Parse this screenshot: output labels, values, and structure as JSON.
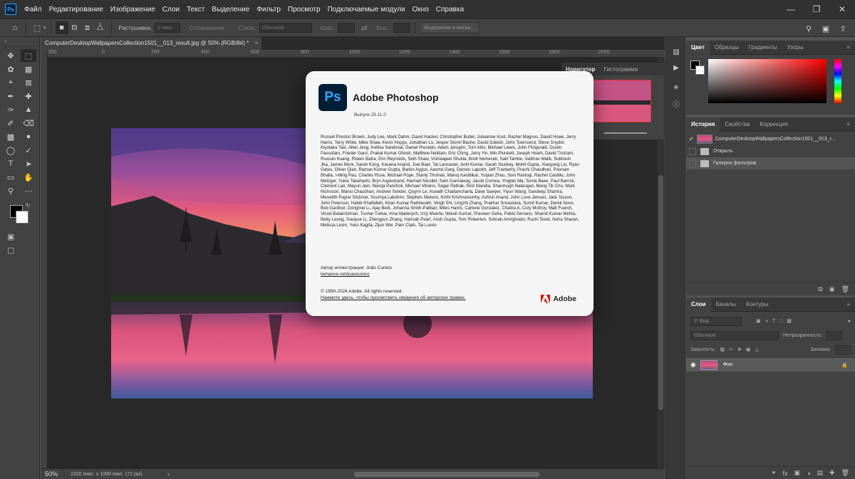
{
  "menubar": {
    "logo": "Ps",
    "items": [
      "Файл",
      "Редактирование",
      "Изображение",
      "Слои",
      "Текст",
      "Выделение",
      "Фильтр",
      "Просмотр",
      "Подключаемые модули",
      "Окно",
      "Справка"
    ]
  },
  "optbar": {
    "feather_label": "Растушевка:",
    "feather_value": "0 пикс.",
    "smoothing_label": "Сглаживание",
    "style_label": "Стиль:",
    "style_value": "Обычный",
    "width_label": "Шир.:",
    "height_label": "Выс.:",
    "select_mask_button": "Выделение и маска..."
  },
  "document": {
    "tab_title": "ComputerDesktopWallpapersCollection1501__013_result.jpg @ 50% (RGB/8#) *",
    "ruler_marks": [
      "200",
      "0",
      "200",
      "400",
      "600",
      "800",
      "1000",
      "1200",
      "1400",
      "1600",
      "1800",
      "2000"
    ],
    "zoom": "50%",
    "info": "1920 пикс. x 1080 пикс. (72 ppi)"
  },
  "navigator": {
    "tabs": [
      "Навигатор",
      "Гистограмма"
    ]
  },
  "color_panel": {
    "tabs": [
      "Цвет",
      "Образцы",
      "Градиенты",
      "Узоры"
    ]
  },
  "history_panel": {
    "tabs": [
      "История",
      "Свойства",
      "Коррекция"
    ],
    "snapshot": "ComputerDesktopWallpapersCollection1501__013_r...",
    "items": [
      "Открыть",
      "Галерея фильтров"
    ]
  },
  "layers_panel": {
    "tabs": [
      "Слои",
      "Каналы",
      "Контуры"
    ],
    "kind_placeholder": "Вид",
    "blend_mode": "Обычные",
    "opacity_label": "Непрозрачность:",
    "lock_label": "Закрепить:",
    "fill_label": "Заливка:",
    "layer_name": "Фон"
  },
  "about": {
    "logo": "Ps",
    "app_name": "Adobe Photoshop",
    "version": "Выпуск 25.11.0",
    "credits": "Russell Preston Brown, Judy Lee, Mark Dahm, David Hackel, Christopher Butler, Julieanne Kost, Rachel Magnus, David Howe, Jerry Harris, Terry White, Mike Shaw, Kevin Hopps, Jonathan Lo, Jesper Storm Bache, David Dobish, John Townsend, Steve Snyder, Kiyotaka Taki, Allen Jeng, Kellisa Sandoval, Daniel Presedo, Adam Jerugim, Tom Attix, Michael Lewis, John Fitzgerald, Dustin Passofaro, Frieder Ganz, Prabal Kumar Ghosh, Matthew Neldam, Eric Ching, Jerry Yin, Min Plunkett, Joseph Hsieh, David Tristram, Ruxuan Kuang, Ridam Batra, Erin Reynolds, Seth Shaw, Vishwajeet Shukla, Brett Nemecek, Salil Tambe, Vaibhav Malik, Subhash Jha, James Mork, Sarah Kong, Kavana Anand, Joel Baer, Tal Lancaster, Amit Kumar, Sarah Stuckey, Mohit Gupta, Xiaoyang Liu, Ryan Gates, Oliver Qian, Raman Kumar Gupta, Barkin Aygun, Aasma Garg, Damon Lapoint, Jeff Tranberry, Prachi Chaudhari, Poonam Bhalla, I-Ming Pao, Charles Rose, Michael Pope, Stanly Thomas, Manoj Kandlikar, Yuqian Zhou, Soni Rastogi, Rachel Castillo, John Metzger, Yukie Takahashi, Bryn Aspestrand, Hannah Nicollet, Sam Gannaway, Jacob Correia, Yinglan Ma, Sonia Baee, Paul Barrick, Clement Lan, Mayuri Jain, Neerja Pancholi, Michael Vitrano, Sagar Pathak, Rick Mandia, Shanmugh Natarajan, Mang Tik Chu, Mark Nichoson, Mansi Chaudhari, Andrew Sender, Quynn Le, Aswath Challamcharla, Dave Sawyer, Yiyun Wang, Sandeep Sharma, Meredith Payne Stotzner, Soumya Lakshmi, Stephen Nielson, Kirthi Krishnamurthy, Ashish Anand, John Love-Jensen, Jack Sisson, John Peterson, Habib Khalfallah, Kiran Kumar Rathlavath, Vergil Shi, Lingzhi Zhang, Prakhar Srivastava, Sumit Kumar, Derek Novo, Bob Gardner, Dongmei Li, Ajay Bedi, Johanna Smith-Palliser, Miles Harris, Carlene Gonzalez, Chaitra A, Cory McIlroy, Matt Fuerch, Vinod Balakrishnan, Tushar Turkar, Irina Maderych, Izzy Muerte, Nitesh Kumar, Praveen Gelra, Pablo Serrano, Shamit Kumar Mehta, Betty Leong, Xiaoyue Li, Zhengyun Zhang, Hannah Pearl, Ansh Gupta, Tom Pinkerton, Sohrab Amirghodsi, Ruchi Sood, Neha Sharan, Melissa Levin, Yuko Kagita, Zijun Wei, Pam Clark, Tai Luxon",
    "illus_label": "Автор иллюстрации: João Cunico",
    "illus_link": "behance.net/joaocunico",
    "copyright": "© 1990-2024 Adobe. All rights reserved.",
    "legal_link": "Нажмите здесь, чтобы просмотреть сведения об авторских правах.",
    "brand": "Adobe"
  }
}
